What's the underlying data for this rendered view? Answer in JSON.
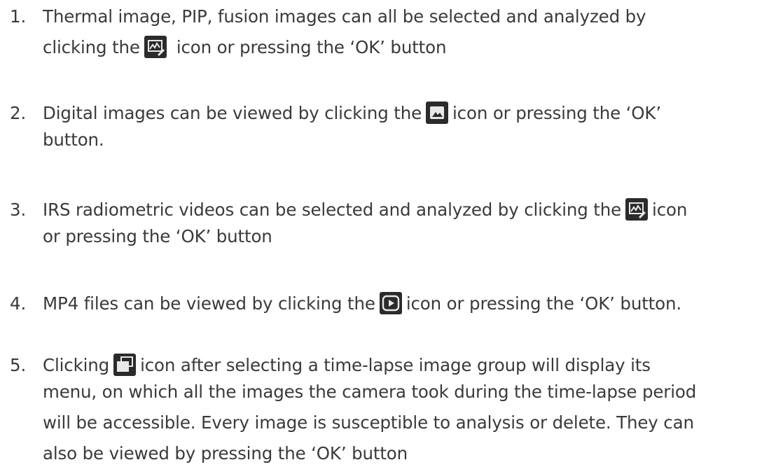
{
  "items": [
    {
      "number": "1.",
      "segments": [
        "Thermal image, PIP, fusion images can all be selected and analyzed by",
        "clicking the",
        "icon or pressing the ‘OK’ button"
      ],
      "icon": "analyze-icon"
    },
    {
      "number": "2.",
      "segments": [
        "Digital images can be viewed by clicking the",
        "icon or pressing the ‘OK’",
        "button."
      ],
      "icon": "image-view-icon"
    },
    {
      "number": "3.",
      "segments": [
        "IRS radiometric videos can be selected and analyzed by clicking the",
        "icon",
        "or pressing the ‘OK’ button"
      ],
      "icon": "analyze-icon"
    },
    {
      "number": "4.",
      "segments": [
        "MP4 files can be viewed by clicking the",
        "icon or pressing the ‘OK’ button."
      ],
      "icon": "play-icon"
    },
    {
      "number": "5.",
      "segments": [
        "Clicking",
        "icon after selecting a time-lapse image group will display its",
        "menu, on which all the images the camera took during the time-lapse period",
        "will be accessible. Every image is susceptible to analysis or delete. They can",
        "also be viewed by pressing the ‘OK’ button"
      ],
      "icon": "time-lapse-group-icon"
    }
  ]
}
